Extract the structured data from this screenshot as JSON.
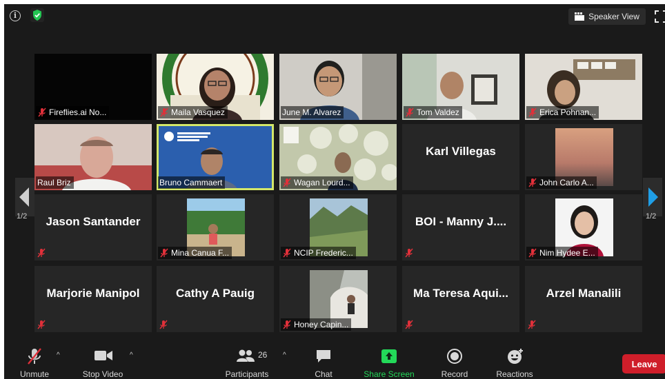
{
  "topbar": {
    "speaker_view_label": "Speaker View"
  },
  "tiles": [
    {
      "name": "Fireflies.ai No...",
      "muted": true,
      "kind": "black"
    },
    {
      "name": "Maila Vasquez",
      "muted": true,
      "kind": "video"
    },
    {
      "name": "June M. Alvarez",
      "muted": false,
      "kind": "video"
    },
    {
      "name": "Tom Valdez",
      "muted": true,
      "kind": "video"
    },
    {
      "name": "Erica Pohnan...",
      "muted": true,
      "kind": "video"
    },
    {
      "name": "Raul Briz",
      "muted": false,
      "kind": "video"
    },
    {
      "name": "Bruno Cammaert",
      "muted": false,
      "kind": "video",
      "active": true
    },
    {
      "name": "Wagan Lourd...",
      "muted": true,
      "kind": "video"
    },
    {
      "name": "Karl Villegas",
      "muted": false,
      "kind": "name"
    },
    {
      "name": "John Carlo A...",
      "muted": true,
      "kind": "photo"
    },
    {
      "name": "Jason Santander",
      "muted": true,
      "kind": "name"
    },
    {
      "name": "Mina Canua F...",
      "muted": true,
      "kind": "photo"
    },
    {
      "name": "NCIP Frederic...",
      "muted": true,
      "kind": "photo"
    },
    {
      "name": "BOI  - Manny J....",
      "muted": true,
      "kind": "name"
    },
    {
      "name": "Nim Hydee E...",
      "muted": true,
      "kind": "photo"
    },
    {
      "name": "Marjorie Manipol",
      "muted": true,
      "kind": "name"
    },
    {
      "name": "Cathy A Pauig",
      "muted": true,
      "kind": "name"
    },
    {
      "name": "Honey Capin...",
      "muted": true,
      "kind": "photo"
    },
    {
      "name": "Ma  Teresa  Aqui...",
      "muted": true,
      "kind": "name"
    },
    {
      "name": "Arzel Manalili",
      "muted": true,
      "kind": "name"
    }
  ],
  "pagination": {
    "left": "1/2",
    "right": "1/2"
  },
  "toolbar": {
    "unmute": "Unmute",
    "stop_video": "Stop Video",
    "participants": "Participants",
    "participants_count": "26",
    "chat": "Chat",
    "share_screen": "Share Screen",
    "record": "Record",
    "reactions": "Reactions",
    "leave": "Leave"
  },
  "colors": {
    "share_green": "#23d959",
    "leave_red": "#cf1e2a",
    "active_speaker": "#d4e86a",
    "muted_red": "#e0303a",
    "nav_arrow": "#1f9ee6"
  }
}
